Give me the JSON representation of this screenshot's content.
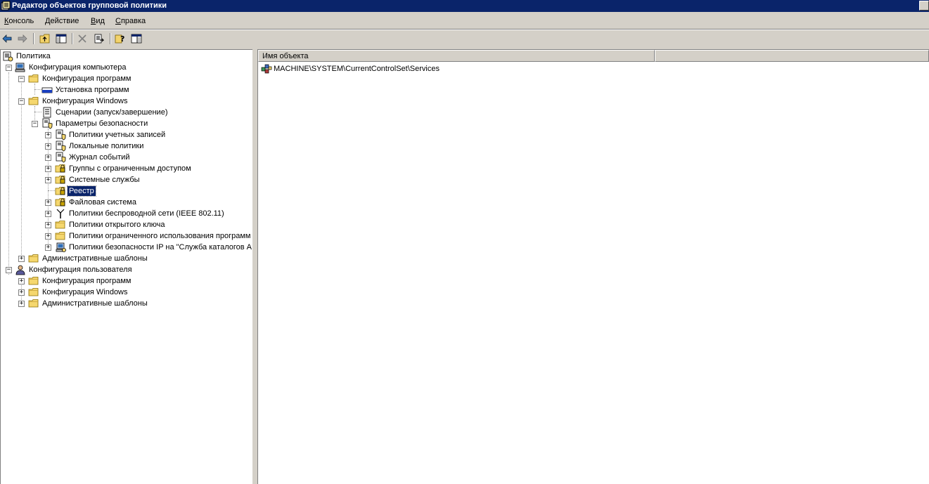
{
  "window": {
    "title": "Редактор объектов групповой политики",
    "icon": "policy-app-icon"
  },
  "menu": [
    {
      "label": "Консоль",
      "underline": "К",
      "rest": "онсоль"
    },
    {
      "label": "Действие",
      "underline": "Д",
      "rest": "ействие"
    },
    {
      "label": "Вид",
      "underline": "В",
      "rest": "ид"
    },
    {
      "label": "Справка",
      "underline": "С",
      "rest": "правка"
    }
  ],
  "toolbar": [
    "back-arrow-icon",
    "forward-arrow-icon",
    "up-folder-icon",
    "show-hide-tree-icon",
    "delete-icon",
    "export-list-icon",
    "help-icon",
    "properties-icon"
  ],
  "tree": {
    "root": "Политика",
    "computer_config": "Конфигурация компьютера",
    "cc_programs": "Конфигурация программ",
    "cc_install": "Установка программ",
    "cc_windows": "Конфигурация Windows",
    "cc_scripts": "Сценарии (запуск/завершение)",
    "cc_security": "Параметры безопасности",
    "sec_accounts": "Политики учетных записей",
    "sec_local": "Локальные политики",
    "sec_eventlog": "Журнал событий",
    "sec_groups": "Группы с ограниченным доступом",
    "sec_services": "Системные службы",
    "sec_registry": "Реестр",
    "sec_filesystem": "Файловая система",
    "sec_wireless": "Политики беспроводной сети (IEEE 802.11)",
    "sec_pubkey": "Политики открытого ключа",
    "sec_restricted": "Политики ограниченного использования программ",
    "sec_ipsec": "Политики безопасности IP на \"Служба каталогов A",
    "cc_admin": "Административные шаблоны",
    "user_config": "Конфигурация пользователя",
    "uc_programs": "Конфигурация программ",
    "uc_windows": "Конфигурация Windows",
    "uc_admin": "Административные шаблоны"
  },
  "list": {
    "column_name": "Имя объекта",
    "sort_glyph": "▲",
    "items": [
      "MACHINE\\SYSTEM\\CurrentControlSet\\Services"
    ]
  },
  "colors": {
    "titlebar": "#0a246a",
    "face": "#d4d0c8",
    "selection": "#0a246a"
  }
}
